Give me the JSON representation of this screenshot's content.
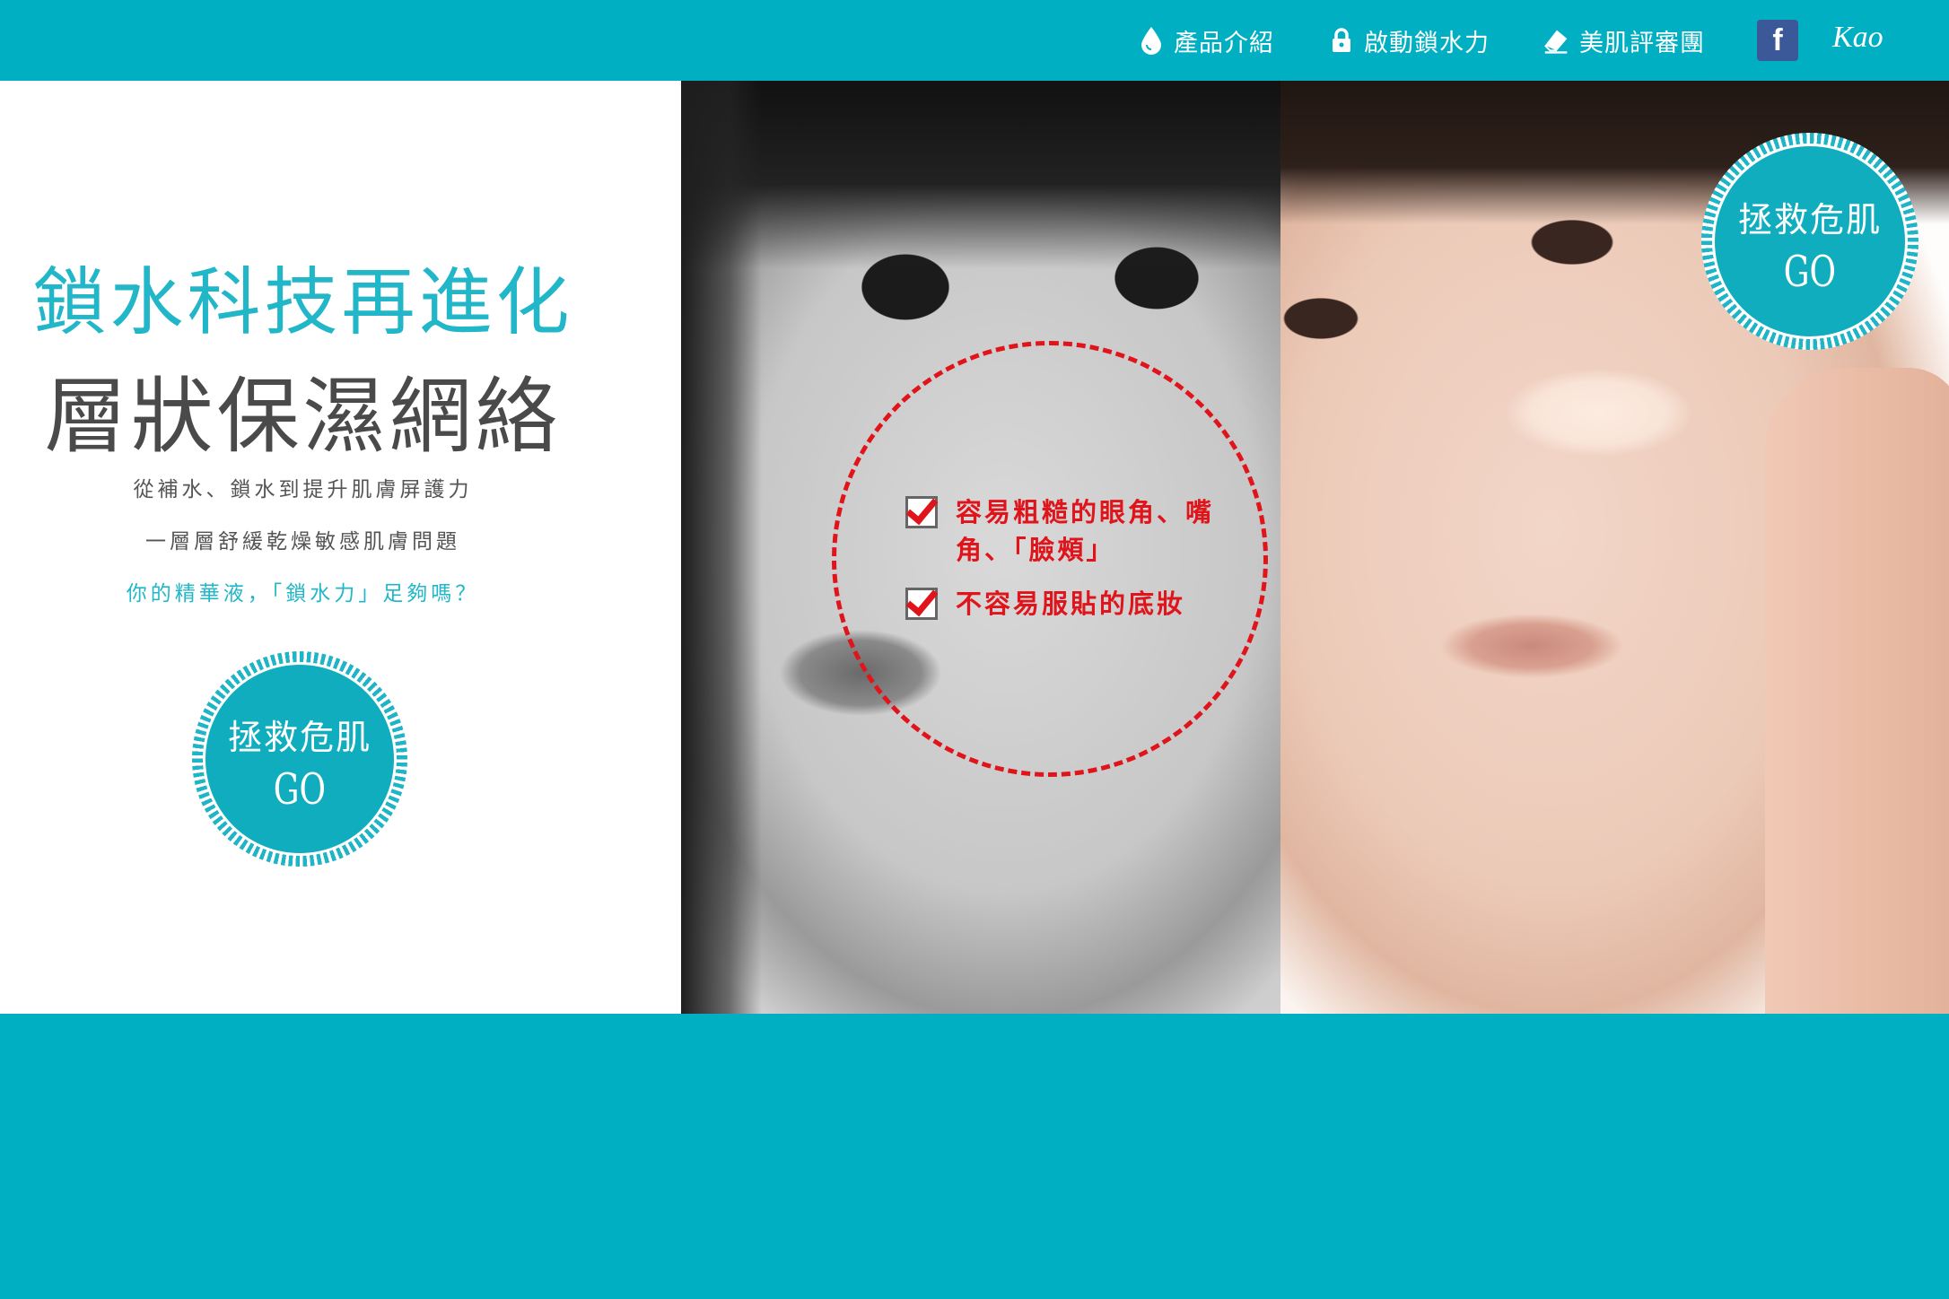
{
  "nav": {
    "items": [
      {
        "label": "產品介紹",
        "icon": "water-drop-icon"
      },
      {
        "label": "啟動鎖水力",
        "icon": "lock-icon"
      },
      {
        "label": "美肌評審團",
        "icon": "eraser-icon"
      }
    ],
    "facebook_label": "f",
    "logo_text": "Kao"
  },
  "hero": {
    "headline_1": "鎖水科技再進化",
    "headline_2": "層狀保濕網絡",
    "sub_1": "從補水、鎖水到提升肌膚屏護力",
    "sub_2": "一層層舒緩乾燥敏感肌膚問題",
    "sub_3": "你的精華液，「鎖水力」足夠嗎？",
    "badge_left": {
      "label": "拯救危肌",
      "go": "GO"
    },
    "badge_right": {
      "label": "拯救危肌",
      "go": "GO"
    },
    "checklist": [
      "容易粗糙的眼角、嘴角、「臉頰」",
      "不容易服貼的底妝"
    ]
  },
  "colors": {
    "brand": "#00b0c2",
    "accent_text": "#22b7c8",
    "alert": "#e0141b",
    "facebook": "#3b5998"
  }
}
